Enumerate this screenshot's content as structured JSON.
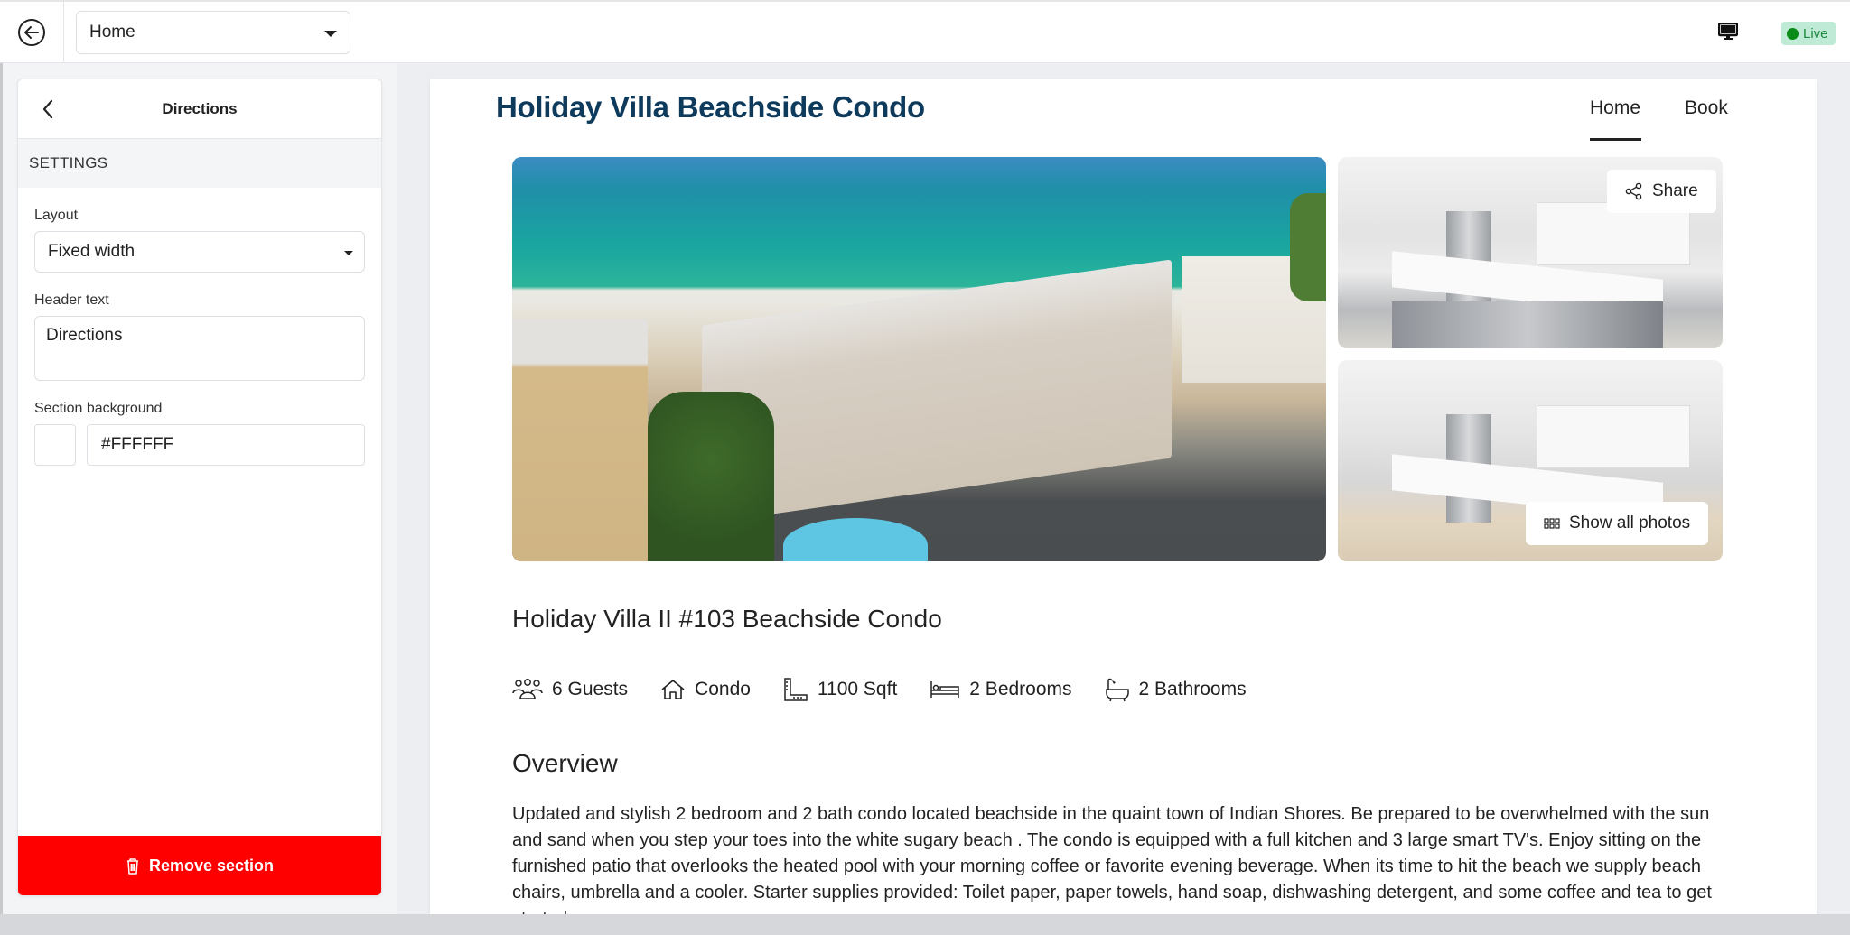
{
  "topbar": {
    "page_select": "Home",
    "live_label": "Live"
  },
  "panel": {
    "title": "Directions",
    "section_label": "SETTINGS",
    "layout_label": "Layout",
    "layout_value": "Fixed width",
    "header_text_label": "Header text",
    "header_text_value": "Directions",
    "background_label": "Section background",
    "background_value": "#FFFFFF",
    "remove_label": "Remove section"
  },
  "colors": {
    "accent_red": "#ff0000",
    "title_navy": "#0e3a5c",
    "live_green": "#0a8a16",
    "section_background": "#FFFFFF"
  },
  "site": {
    "title": "Holiday Villa Beachside Condo",
    "nav": [
      {
        "label": "Home",
        "active": true
      },
      {
        "label": "Book",
        "active": false
      }
    ],
    "share_label": "Share",
    "show_all_photos_label": "Show all photos",
    "listing_title": "Holiday Villa II #103 Beachside Condo",
    "facts": [
      {
        "icon": "guests-icon",
        "label": "6 Guests"
      },
      {
        "icon": "house-icon",
        "label": "Condo"
      },
      {
        "icon": "ruler-icon",
        "label": "1100 Sqft"
      },
      {
        "icon": "bed-icon",
        "label": "2 Bedrooms"
      },
      {
        "icon": "bathtub-icon",
        "label": "2 Bathrooms"
      }
    ],
    "overview_heading": "Overview",
    "overview_text": "Updated and stylish 2 bedroom and 2 bath condo located beachside in the quaint town of Indian Shores. Be prepared to be overwhelmed with the sun and sand when you step your toes into the white sugary beach . The condo is equipped with a full kitchen and 3 large smart TV's. Enjoy sitting on the furnished patio that overlooks the heated pool with your morning coffee or favorite evening beverage. When its time to hit the beach we supply beach chairs, umbrella and a cooler. Starter supplies provided: Toilet paper, paper towels, hand soap, dishwashing detergent, and some coffee and tea to get started."
  }
}
